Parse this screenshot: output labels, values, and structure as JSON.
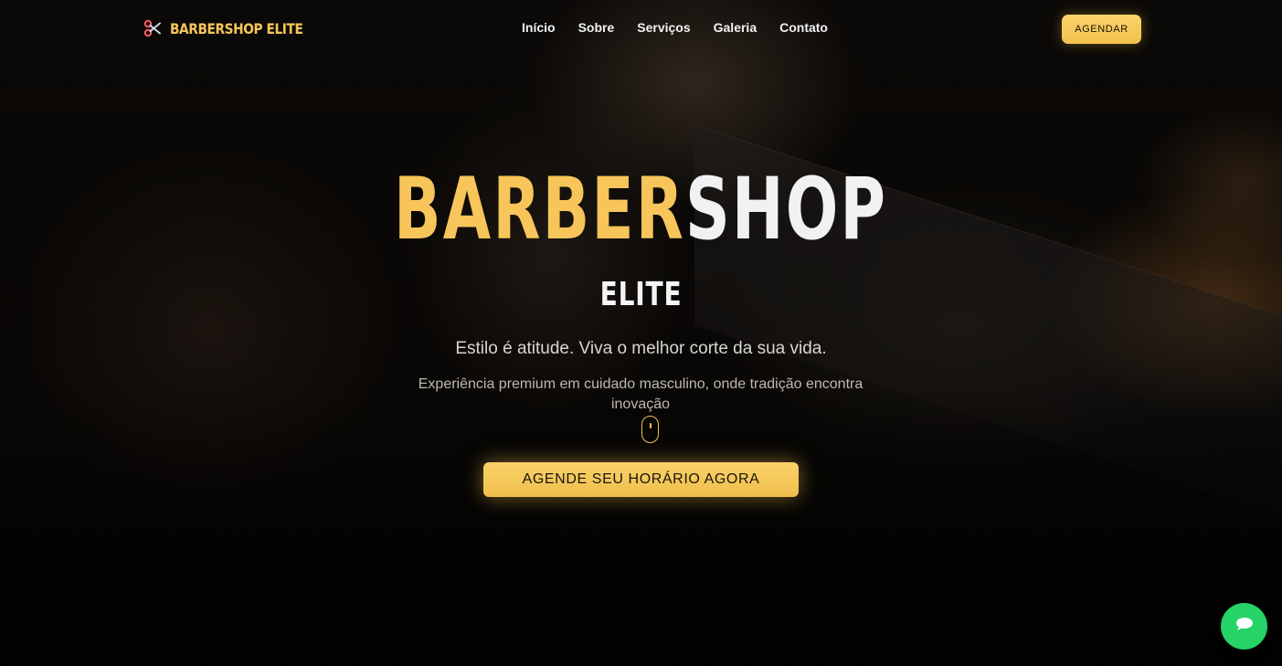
{
  "brand": {
    "name": "BARBERSHOP ELITE",
    "icon": "scissors-icon"
  },
  "nav": {
    "links": [
      "Início",
      "Sobre",
      "Serviços",
      "Galeria",
      "Contato"
    ]
  },
  "header_cta": "AGENDAR",
  "hero": {
    "title_part1": "BARBER",
    "title_part2": "SHOP",
    "subtitle": "ELITE",
    "tagline": "Estilo é atitude. Viva o melhor corte da sua vida.",
    "description": "Experiência premium em cuidado masculino, onde tradição encontra inovação",
    "scroll_indicator_icon": "mouse-scroll-icon",
    "cta": "AGENDE SEU HORÁRIO AGORA"
  },
  "chat": {
    "icon": "chat-bubble-icon"
  },
  "colors": {
    "accent": "#f7c55a",
    "title_light": "#f1f1f3",
    "background": "#050403",
    "chat_green": "#25d366"
  }
}
